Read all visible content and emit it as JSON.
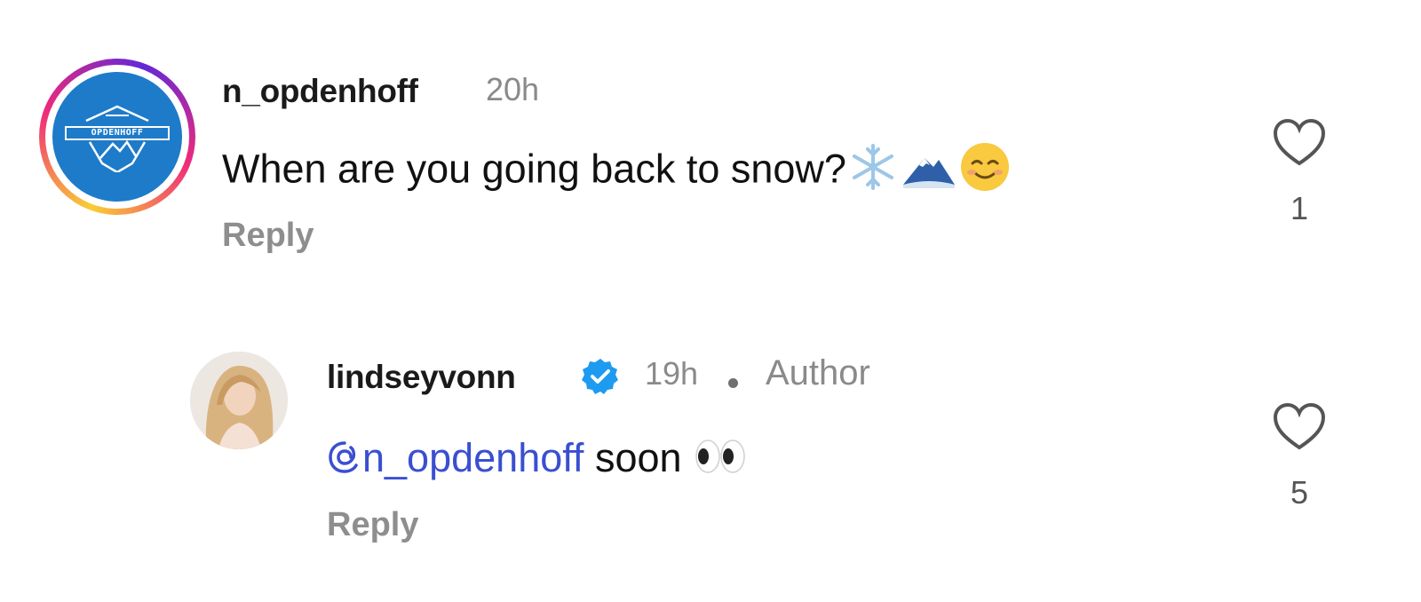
{
  "comments": [
    {
      "username": "n_opdenhoff",
      "time": "20h",
      "text": "When are you going back to snow?",
      "emojis": [
        "snowflake-icon",
        "snow-mountain-icon",
        "smiling-face-icon"
      ],
      "reply_label": "Reply",
      "like_count": "1",
      "avatar_text": "OPDENHOFF"
    },
    {
      "username": "lindseyvonn",
      "verified": true,
      "time": "19h",
      "author_label": "Author",
      "mention": "n_opdenhoff",
      "text": "soon",
      "emojis": [
        "eyes-icon"
      ],
      "reply_label": "Reply",
      "like_count": "5"
    }
  ],
  "colors": {
    "mention": "#3a4fd0",
    "verified": "#1d9bf0",
    "muted": "#8a8a8a",
    "avatar_blue": "#1e7bc9"
  }
}
